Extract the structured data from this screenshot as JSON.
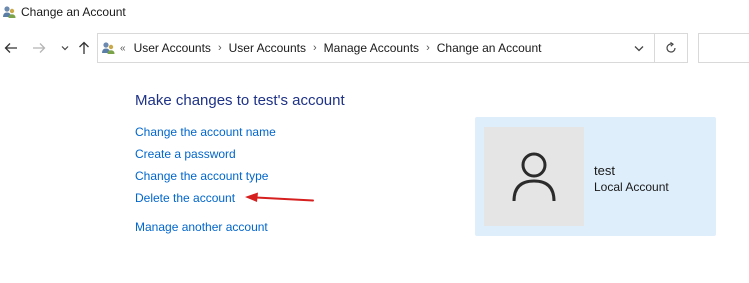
{
  "window": {
    "title": "Change an Account",
    "icon": "user-accounts-icon"
  },
  "navigation": {
    "back_icon": "back-arrow-icon",
    "forward_icon": "forward-arrow-icon",
    "recent_icon": "chevron-down-icon",
    "up_icon": "up-arrow-icon",
    "breadcrumb_overflow": "«",
    "separator": "›",
    "breadcrumbs": [
      "User Accounts",
      "User Accounts",
      "Manage Accounts",
      "Change an Account"
    ],
    "refresh_icon": "refresh-icon",
    "search_placeholder": ""
  },
  "main": {
    "heading": "Make changes to test's account",
    "links": [
      "Change the account name",
      "Create a password",
      "Change the account type",
      "Delete the account",
      "Manage another account"
    ]
  },
  "account": {
    "name": "test",
    "type": "Local Account",
    "avatar_icon": "user-avatar-icon"
  },
  "annotation": {
    "arrow_color": "#d62020"
  },
  "colors": {
    "link": "#0066cc",
    "heading": "#1e3287",
    "tile_background": "#deeefb",
    "avatar_background": "#e5e5e5"
  }
}
